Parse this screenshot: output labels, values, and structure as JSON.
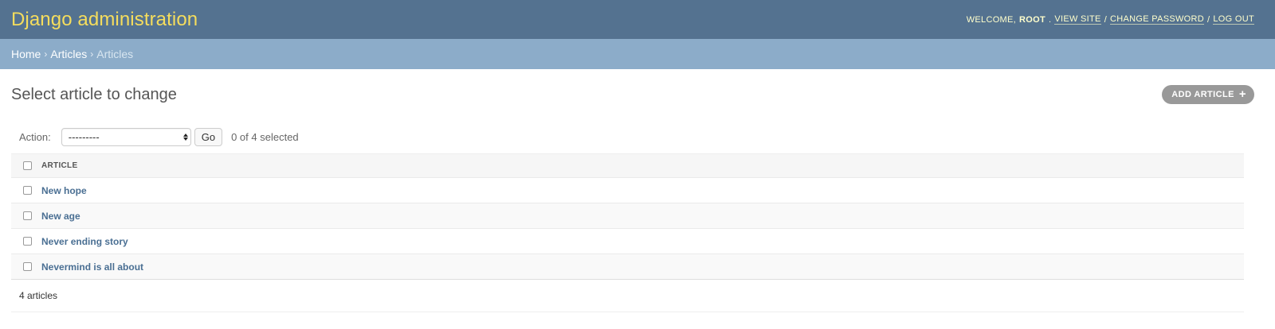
{
  "header": {
    "branding": "Django administration",
    "welcome": "Welcome,",
    "username": "root",
    "view_site": "View site",
    "change_password": "Change password",
    "log_out": "Log out",
    "separator": "/"
  },
  "breadcrumbs": {
    "home": "Home",
    "app": "Articles",
    "current": "Articles",
    "separator": "›"
  },
  "page": {
    "title": "Select article to change",
    "add_button": "Add article",
    "add_icon": "+"
  },
  "actions": {
    "label": "Action:",
    "selected_value": "---------",
    "go_label": "Go",
    "selected_count": "0 of 4 selected"
  },
  "table": {
    "column_header": "Article",
    "rows": [
      {
        "title": "New hope"
      },
      {
        "title": "New age"
      },
      {
        "title": "Never ending story"
      },
      {
        "title": "Nevermind is all about"
      }
    ]
  },
  "paginator": {
    "count_text": "4 articles"
  },
  "colors": {
    "header_bg": "#547290",
    "branding": "#f5dd5d",
    "breadcrumbs_bg": "#8cacc9",
    "link": "#4a6f93",
    "add_button_bg": "#999999"
  }
}
